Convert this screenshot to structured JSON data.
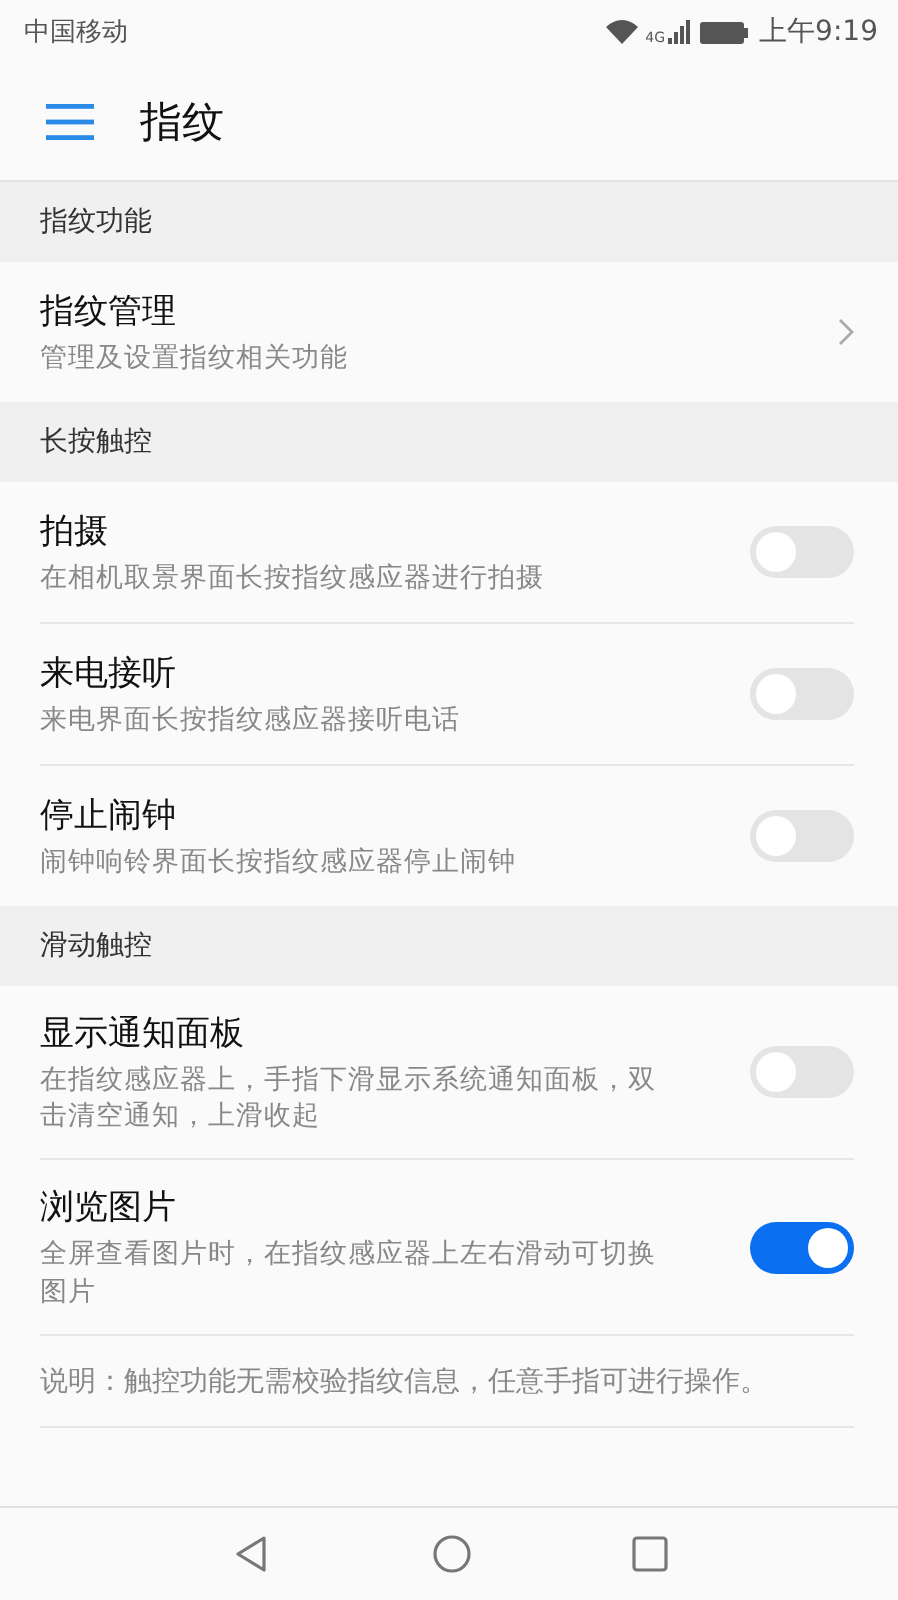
{
  "status_bar": {
    "carrier": "中国移动",
    "network": "4G",
    "time": "上午9:19"
  },
  "app_bar": {
    "title": "指纹"
  },
  "sections": [
    {
      "header": "指纹功能",
      "items": [
        {
          "kind": "link",
          "title": "指纹管理",
          "subtitle": "管理及设置指纹相关功能"
        }
      ]
    },
    {
      "header": "长按触控",
      "items": [
        {
          "kind": "switch",
          "title": "拍摄",
          "subtitle": "在相机取景界面长按指纹感应器进行拍摄",
          "on": false
        },
        {
          "kind": "switch",
          "title": "来电接听",
          "subtitle": "来电界面长按指纹感应器接听电话",
          "on": false
        },
        {
          "kind": "switch",
          "title": "停止闹钟",
          "subtitle": "闹钟响铃界面长按指纹感应器停止闹钟",
          "on": false
        }
      ]
    },
    {
      "header": "滑动触控",
      "items": [
        {
          "kind": "switch",
          "title": "显示通知面板",
          "subtitle": "在指纹感应器上，手指下滑显示系统通知面板，双击清空通知，上滑收起",
          "on": false
        },
        {
          "kind": "switch",
          "title": "浏览图片",
          "subtitle": "全屏查看图片时，在指纹感应器上左右滑动可切换图片",
          "on": true
        }
      ]
    }
  ],
  "note": "说明：触控功能无需校验指纹信息，任意手指可进行操作。"
}
